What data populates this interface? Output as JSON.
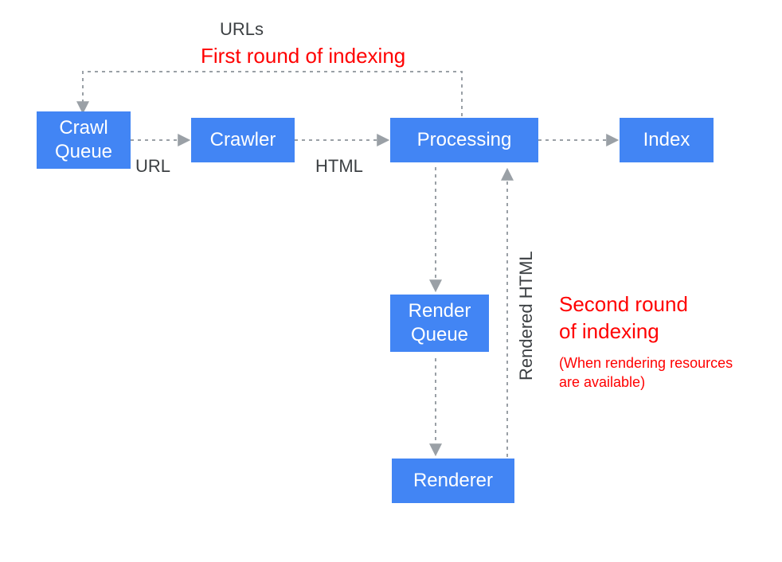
{
  "nodes": {
    "crawl_queue": "Crawl\nQueue",
    "crawler": "Crawler",
    "processing": "Processing",
    "index": "Index",
    "render_queue": "Render\nQueue",
    "renderer": "Renderer"
  },
  "edge_labels": {
    "urls": "URLs",
    "url": "URL",
    "html": "HTML",
    "rendered_html": "Rendered HTML"
  },
  "annotations": {
    "first_round": "First round of indexing",
    "second_round_line": "Second round\nof indexing",
    "second_round_note": "(When rendering resources\nare available)"
  },
  "colors": {
    "node_fill": "#4285f4",
    "node_shadow": "#c8d7f2",
    "edge": "#9aa0a6",
    "edge_label": "#3c4043",
    "annotation": "#ff0000"
  }
}
